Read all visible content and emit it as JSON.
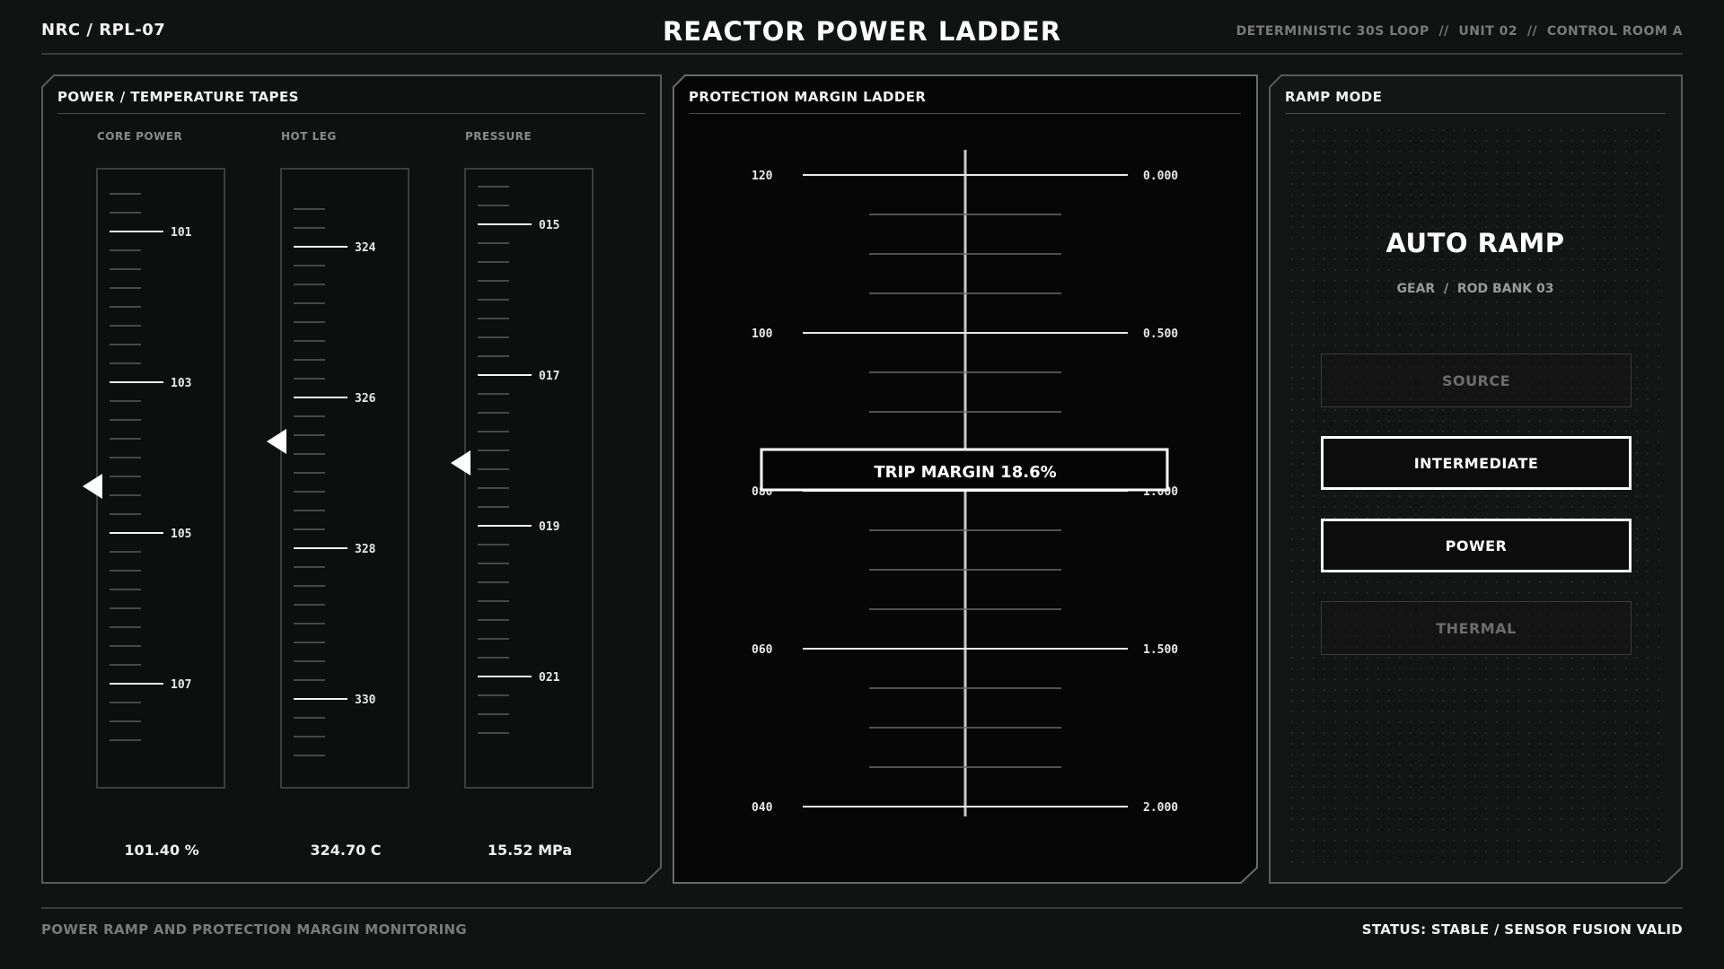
{
  "header": {
    "id": "NRC / RPL-07",
    "title": "REACTOR POWER LADDER",
    "right": "DETERMINISTIC 30S LOOP  //  UNIT 02  //  CONTROL ROOM A"
  },
  "tapes_panel": {
    "title": "POWER / TEMPERATURE TAPES",
    "tapes": [
      {
        "label": "CORE POWER",
        "major_labels": [
          "101",
          "103",
          "105",
          "107"
        ],
        "readout": "101.40 %"
      },
      {
        "label": "HOT LEG",
        "major_labels": [
          "324",
          "326",
          "328",
          "330"
        ],
        "readout": "324.70 C"
      },
      {
        "label": "PRESSURE",
        "major_labels": [
          "015",
          "017",
          "019",
          "021"
        ],
        "readout": "15.52 MPa"
      }
    ]
  },
  "ladder_panel": {
    "title": "PROTECTION MARGIN LADDER",
    "left_labels": [
      "120",
      "100",
      "080",
      "060",
      "040"
    ],
    "right_labels": [
      "0.000",
      "0.500",
      "1.000",
      "1.500",
      "2.000"
    ],
    "trip_margin": "TRIP MARGIN 18.6%"
  },
  "ramp_panel": {
    "title": "RAMP MODE",
    "mode": "AUTO RAMP",
    "sub": "GEAR  /  ROD BANK 03",
    "buttons": [
      {
        "label": "SOURCE",
        "active": false
      },
      {
        "label": "INTERMEDIATE",
        "active": true
      },
      {
        "label": "POWER",
        "active": true
      },
      {
        "label": "THERMAL",
        "active": false
      }
    ]
  },
  "footer": {
    "left": "POWER RAMP AND PROTECTION MARGIN MONITORING",
    "right": "STATUS: STABLE / SENSOR FUSION VALID"
  },
  "colors": {
    "background": "#111212",
    "panel": "#0d0e0e",
    "frame": "#5a5b5b",
    "accent": "#ffffff"
  }
}
